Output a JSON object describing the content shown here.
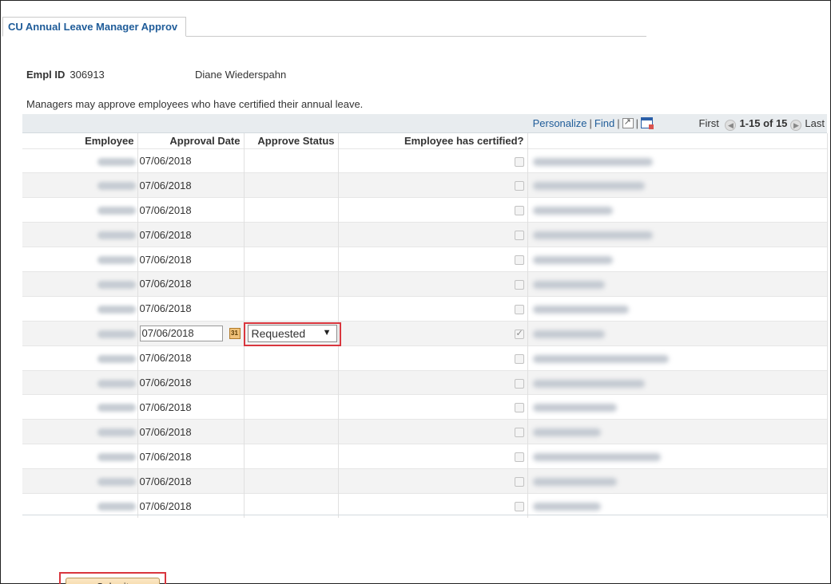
{
  "tab": {
    "label": "CU Annual Leave Manager Approv"
  },
  "employee": {
    "id_label": "Empl ID",
    "id_value": "306913",
    "name": "Diane Wiederspahn"
  },
  "instructions": "Managers may approve employees who have certified their annual leave.",
  "grid": {
    "links": {
      "personalize": "Personalize",
      "find": "Find",
      "sep": "|"
    },
    "nav": {
      "first": "First",
      "range": "1-15 of 15",
      "last": "Last"
    },
    "columns": [
      "Employee",
      "Approval Date",
      "Approve Status",
      "Employee has certified?"
    ],
    "rows": [
      {
        "date": "07/06/2018",
        "status": "",
        "certified": false,
        "editable": false
      },
      {
        "date": "07/06/2018",
        "status": "",
        "certified": false,
        "editable": false
      },
      {
        "date": "07/06/2018",
        "status": "",
        "certified": false,
        "editable": false
      },
      {
        "date": "07/06/2018",
        "status": "",
        "certified": false,
        "editable": false
      },
      {
        "date": "07/06/2018",
        "status": "",
        "certified": false,
        "editable": false
      },
      {
        "date": "07/06/2018",
        "status": "",
        "certified": false,
        "editable": false
      },
      {
        "date": "07/06/2018",
        "status": "",
        "certified": false,
        "editable": false
      },
      {
        "date": "07/06/2018",
        "status": "Requested",
        "certified": true,
        "editable": true
      },
      {
        "date": "07/06/2018",
        "status": "",
        "certified": false,
        "editable": false
      },
      {
        "date": "07/06/2018",
        "status": "",
        "certified": false,
        "editable": false
      },
      {
        "date": "07/06/2018",
        "status": "",
        "certified": false,
        "editable": false
      },
      {
        "date": "07/06/2018",
        "status": "",
        "certified": false,
        "editable": false
      },
      {
        "date": "07/06/2018",
        "status": "",
        "certified": false,
        "editable": false
      },
      {
        "date": "07/06/2018",
        "status": "",
        "certified": false,
        "editable": false
      },
      {
        "date": "07/06/2018",
        "status": "",
        "certified": false,
        "editable": false
      }
    ]
  },
  "submit_label": "Submit",
  "colors": {
    "link": "#1f5c99",
    "highlight": "#d9363e",
    "header_bg": "#e8ecef",
    "alt_row": "#f3f3f3"
  }
}
